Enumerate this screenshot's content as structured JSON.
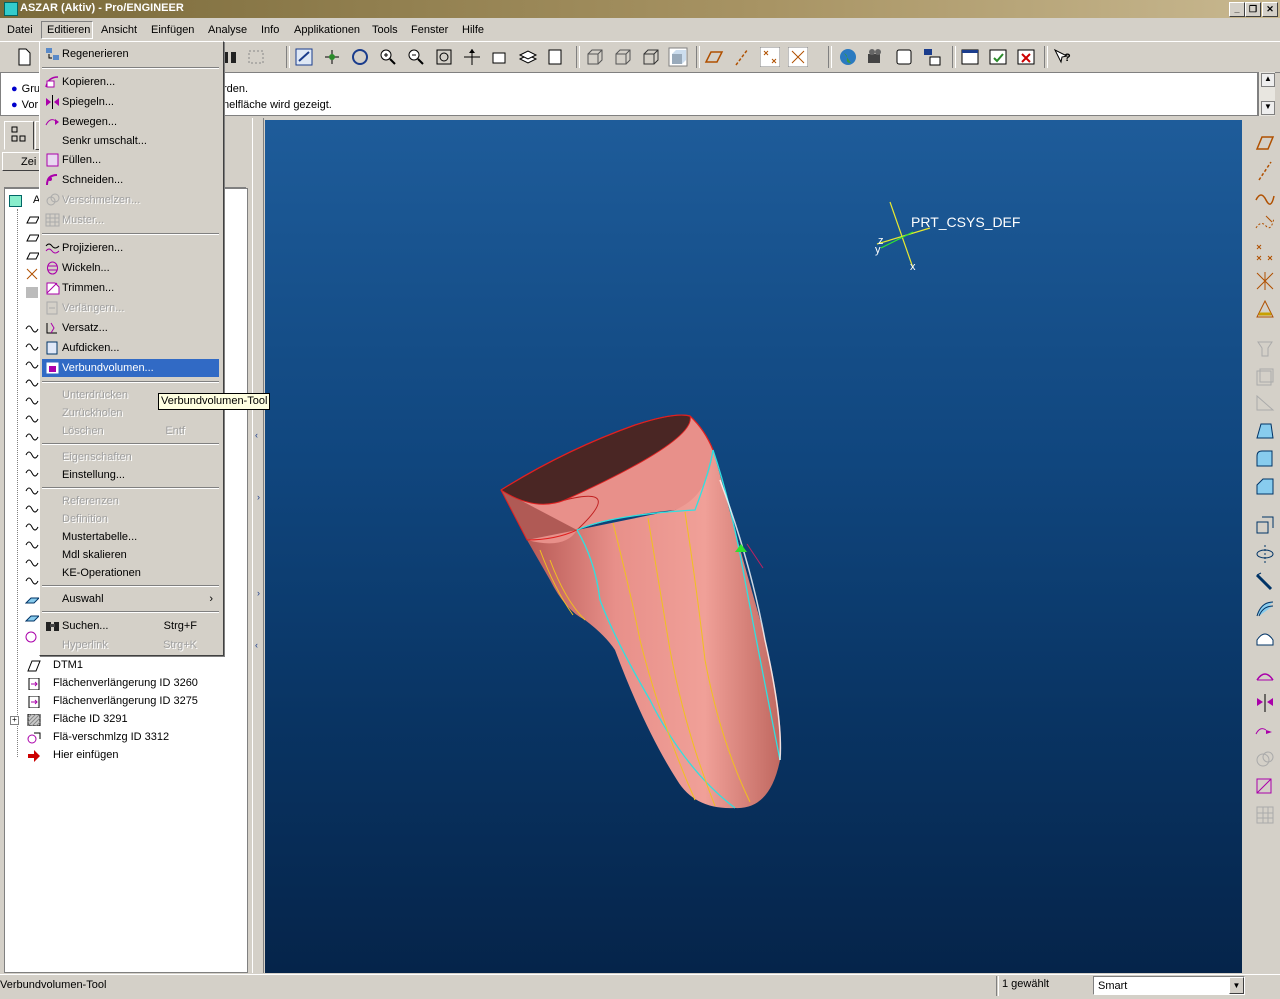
{
  "window": {
    "title": "ASZAR (Aktiv) - Pro/ENGINEER"
  },
  "menubar": [
    "Datei",
    "Editieren",
    "Ansicht",
    "Einfügen",
    "Analyse",
    "Info",
    "Applikationen",
    "Tools",
    "Fenster",
    "Hilfe"
  ],
  "messages": {
    "line1": "Gru",
    "line1_end": "rden.",
    "line2": "Vor",
    "line2_end": "nelfläche wird gezeigt."
  },
  "left_panel": {
    "zeig_label": "Zei",
    "root_label": "A"
  },
  "tree": [
    {
      "label": "DTM1",
      "icon": "datum-plane-icon"
    },
    {
      "label": "Flächenverlängerung ID 3260",
      "icon": "surface-extend-icon"
    },
    {
      "label": "Flächenverlängerung ID 3275",
      "icon": "surface-extend-icon"
    },
    {
      "label": "Fläche ID 3291",
      "icon": "surface-icon"
    },
    {
      "label": "Flä-verschmlzg ID 3312",
      "icon": "surface-merge-icon"
    },
    {
      "label": "Hier einfügen",
      "icon": "insert-here-arrow-icon"
    }
  ],
  "edit_menu": {
    "items": [
      {
        "label": "Regenerieren",
        "icon": "regenerate-icon",
        "shortcut": "",
        "disabled": false
      },
      {
        "label": "Kopieren...",
        "icon": "copy-icon",
        "shortcut": "",
        "disabled": false
      },
      {
        "label": "Spiegeln...",
        "icon": "mirror-icon",
        "shortcut": "",
        "disabled": false
      },
      {
        "label": "Bewegen...",
        "icon": "move-icon",
        "shortcut": "",
        "disabled": false
      },
      {
        "label": "Senkr umschalt...",
        "icon": "",
        "shortcut": "",
        "disabled": false
      },
      {
        "label": "Füllen...",
        "icon": "fill-icon",
        "shortcut": "",
        "disabled": false
      },
      {
        "label": "Schneiden...",
        "icon": "intersect-icon",
        "shortcut": "",
        "disabled": false
      },
      {
        "label": "Verschmelzen...",
        "icon": "merge-icon",
        "shortcut": "",
        "disabled": true
      },
      {
        "label": "Muster...",
        "icon": "pattern-icon",
        "shortcut": "",
        "disabled": true
      },
      {
        "label": "Projizieren...",
        "icon": "project-icon",
        "shortcut": "",
        "disabled": false
      },
      {
        "label": "Wickeln...",
        "icon": "wrap-icon",
        "shortcut": "",
        "disabled": false
      },
      {
        "label": "Trimmen...",
        "icon": "trim-icon",
        "shortcut": "",
        "disabled": false
      },
      {
        "label": "Verlängern...",
        "icon": "extend-icon",
        "shortcut": "",
        "disabled": true
      },
      {
        "label": "Versatz...",
        "icon": "offset-icon",
        "shortcut": "",
        "disabled": false
      },
      {
        "label": "Aufdicken...",
        "icon": "thicken-icon",
        "shortcut": "",
        "disabled": false
      },
      {
        "label": "Verbundvolumen...",
        "icon": "solidify-icon",
        "shortcut": "",
        "disabled": false,
        "selected": true
      },
      {
        "label": "Unterdrücken",
        "icon": "",
        "shortcut": "",
        "disabled": true
      },
      {
        "label": "Zurückholen",
        "icon": "",
        "shortcut": "",
        "disabled": true
      },
      {
        "label": "Löschen",
        "icon": "",
        "shortcut": "Entf",
        "disabled": true
      },
      {
        "label": "Eigenschaften",
        "icon": "",
        "shortcut": "",
        "disabled": true
      },
      {
        "label": "Einstellung...",
        "icon": "",
        "shortcut": "",
        "disabled": false
      },
      {
        "label": "Referenzen",
        "icon": "",
        "shortcut": "",
        "disabled": true
      },
      {
        "label": "Definition",
        "icon": "",
        "shortcut": "",
        "disabled": true
      },
      {
        "label": "Mustertabelle...",
        "icon": "",
        "shortcut": "",
        "disabled": false
      },
      {
        "label": "Mdl skalieren",
        "icon": "",
        "shortcut": "",
        "disabled": false
      },
      {
        "label": "KE-Operationen",
        "icon": "",
        "shortcut": "",
        "disabled": false
      },
      {
        "label": "Auswahl",
        "icon": "",
        "shortcut": "›",
        "disabled": false
      },
      {
        "label": "Suchen...",
        "icon": "binoculars-icon",
        "shortcut": "Strg+F",
        "disabled": false
      },
      {
        "label": "Hyperlink",
        "icon": "",
        "shortcut": "Strg+K",
        "disabled": true
      }
    ]
  },
  "tooltip": "Verbundvolumen-Tool",
  "viewport": {
    "csys_label": "PRT_CSYS_DEF",
    "axis_x": "x",
    "axis_y": "y",
    "axis_z": "z"
  },
  "status": {
    "message": "Verbundvolumen-Tool",
    "selected": "1 gewählt",
    "filter": "Smart"
  },
  "colors": {
    "model": "#e88a82",
    "selection": "#316ac5",
    "background_top": "#1e5c9a",
    "background_bottom": "#05244a"
  }
}
